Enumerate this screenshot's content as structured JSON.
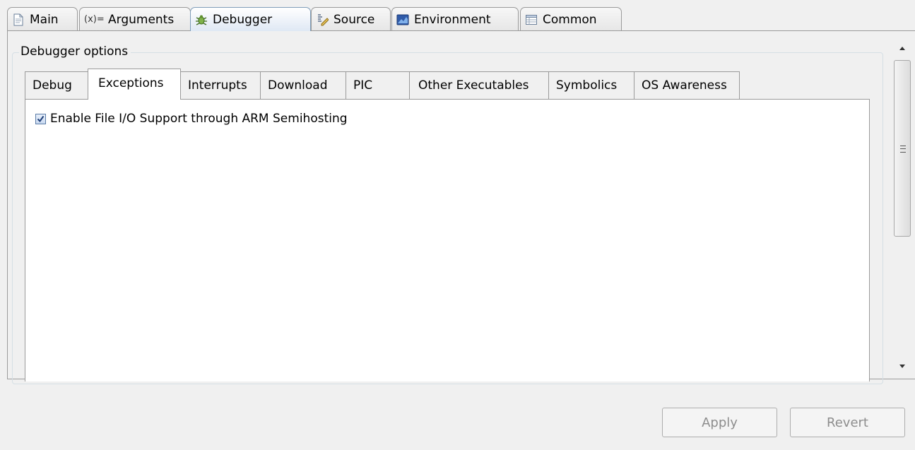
{
  "top_tabs": [
    {
      "label": "Main",
      "icon": "document-icon"
    },
    {
      "label": "Arguments",
      "icon": "variable-icon"
    },
    {
      "label": "Debugger",
      "icon": "bug-icon"
    },
    {
      "label": "Source",
      "icon": "source-icon"
    },
    {
      "label": "Environment",
      "icon": "environment-icon"
    },
    {
      "label": "Common",
      "icon": "table-icon"
    }
  ],
  "selected_top_tab": "Debugger",
  "group_title": "Debugger options",
  "inner_tabs": [
    "Debug",
    "Exceptions",
    "Interrupts",
    "Download",
    "PIC",
    "Other Executables",
    "Symbolics",
    "OS Awareness"
  ],
  "selected_inner_tab": "Exceptions",
  "checkbox": {
    "label": "Enable File I/O Support through ARM Semihosting",
    "checked": true
  },
  "buttons": {
    "apply": "Apply",
    "revert": "Revert"
  },
  "colors": {
    "selected_tab_border": "#7f9db9",
    "checkbox_border": "#5a7ba6",
    "disabled_text": "#8d8d8d"
  }
}
